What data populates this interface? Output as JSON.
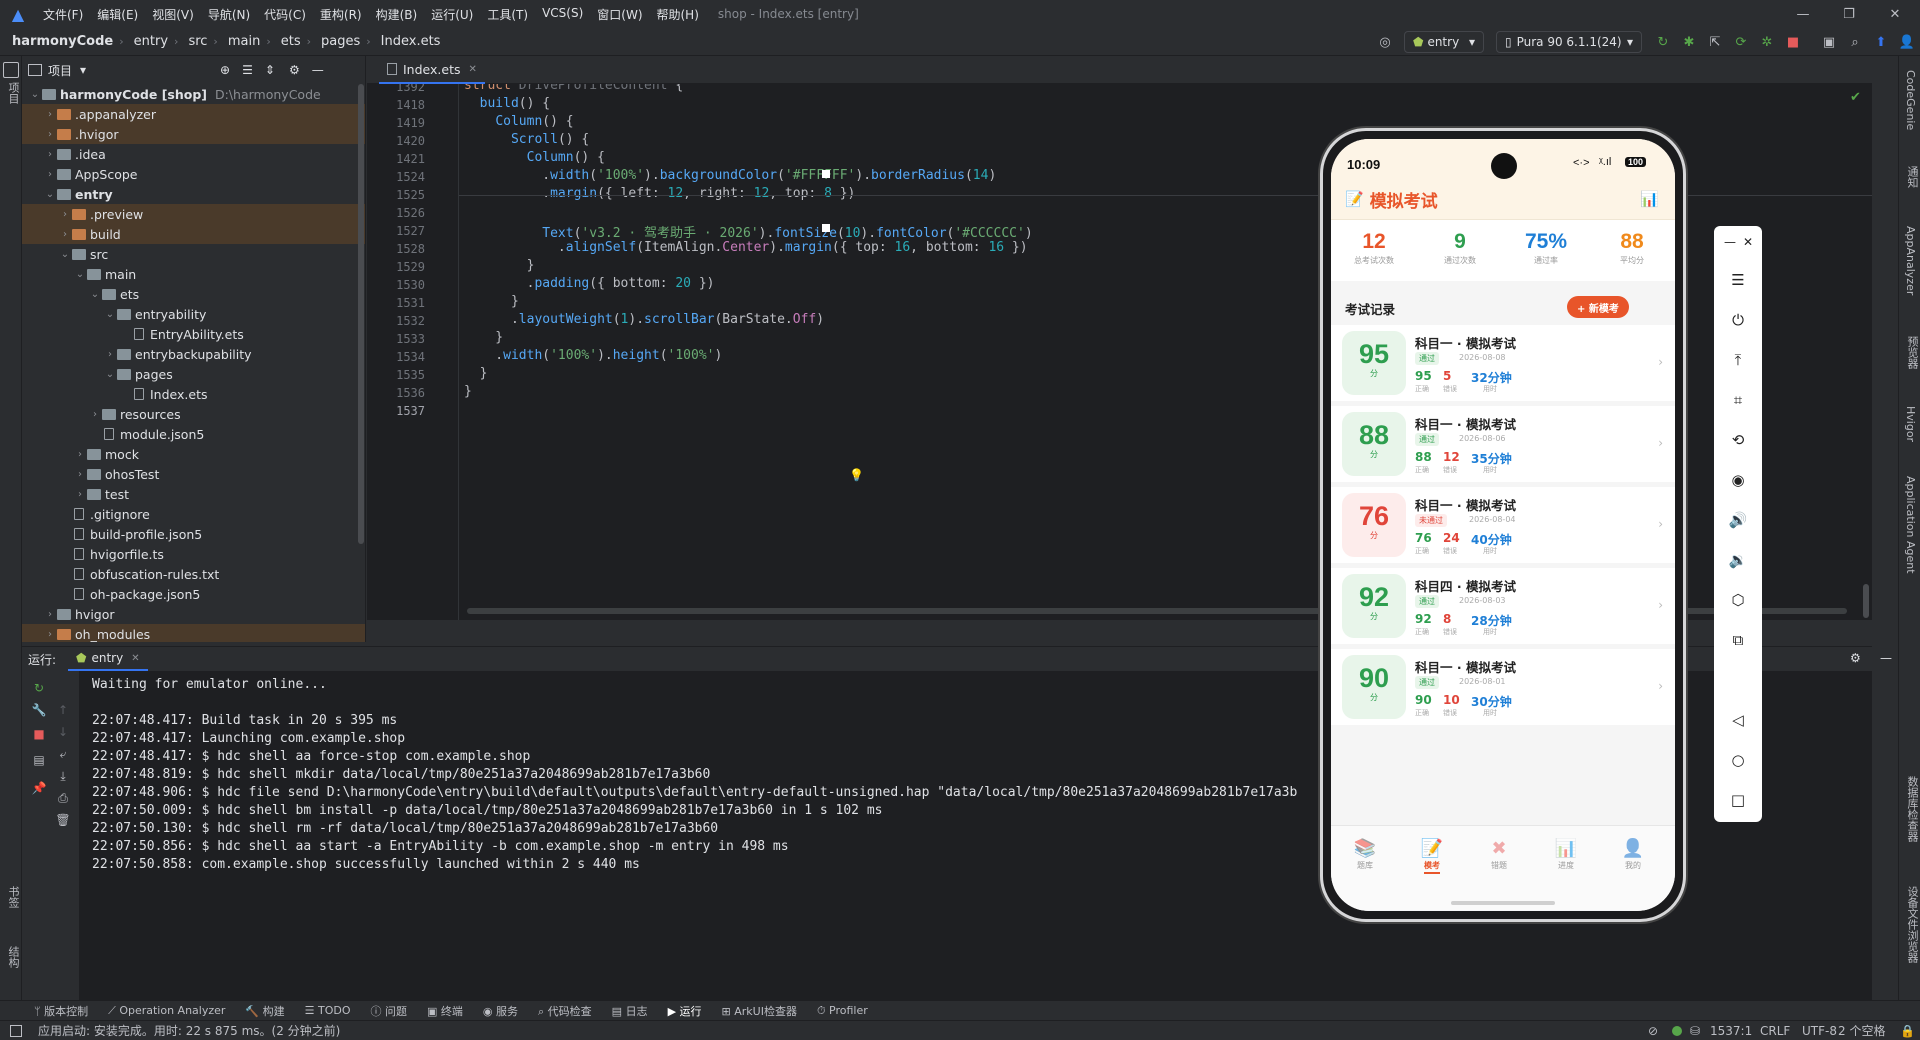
{
  "menubar": {
    "items": [
      "文件(F)",
      "编辑(E)",
      "视图(V)",
      "导航(N)",
      "代码(C)",
      "重构(R)",
      "构建(B)",
      "运行(U)",
      "工具(T)",
      "VCS(S)",
      "窗口(W)",
      "帮助(H)"
    ],
    "title": "shop - Index.ets [entry]"
  },
  "breadcrumb": [
    "harmonyCode",
    "entry",
    "src",
    "main",
    "ets",
    "pages",
    "Index.ets"
  ],
  "toolbar": {
    "run_config": "entry",
    "device": "Pura 90 6.1.1(24)"
  },
  "left_strip": {
    "project": "项目",
    "bookmarks": "书签",
    "structure": "结构"
  },
  "right_strip": {
    "codegenie": "CodeGenie",
    "notifications": "通知",
    "appanalyzer": "AppAnalyzer",
    "preview": "预览器",
    "hvigor": "Hvigor",
    "agent": "Application Agent",
    "db": "数据库检查器",
    "device_files": "设备文件浏览器"
  },
  "project_panel": {
    "title": "项目",
    "tree": [
      {
        "label": "harmonyCode [shop]",
        "hint": "D:\\harmonyCode",
        "depth": 0,
        "open": true,
        "kind": "folder",
        "excl": false,
        "bold": true
      },
      {
        "label": ".appanalyzer",
        "depth": 1,
        "open": false,
        "kind": "folder-or",
        "excl": true
      },
      {
        "label": ".hvigor",
        "depth": 1,
        "open": false,
        "kind": "folder-or",
        "excl": true
      },
      {
        "label": ".idea",
        "depth": 1,
        "open": false,
        "kind": "folder",
        "excl": false
      },
      {
        "label": "AppScope",
        "depth": 1,
        "open": false,
        "kind": "folder",
        "excl": false
      },
      {
        "label": "entry",
        "depth": 1,
        "open": true,
        "kind": "folder",
        "excl": false,
        "bold": true
      },
      {
        "label": ".preview",
        "depth": 2,
        "open": false,
        "kind": "folder-or",
        "excl": true
      },
      {
        "label": "build",
        "depth": 2,
        "open": false,
        "kind": "folder-or",
        "excl": true
      },
      {
        "label": "src",
        "depth": 2,
        "open": true,
        "kind": "folder",
        "excl": false
      },
      {
        "label": "main",
        "depth": 3,
        "open": true,
        "kind": "folder",
        "excl": false
      },
      {
        "label": "ets",
        "depth": 4,
        "open": true,
        "kind": "folder",
        "excl": false
      },
      {
        "label": "entryability",
        "depth": 5,
        "open": true,
        "kind": "folder",
        "excl": false
      },
      {
        "label": "EntryAbility.ets",
        "depth": 6,
        "kind": "file",
        "excl": false
      },
      {
        "label": "entrybackupability",
        "depth": 5,
        "open": false,
        "kind": "folder",
        "excl": false
      },
      {
        "label": "pages",
        "depth": 5,
        "open": true,
        "kind": "folder",
        "excl": false
      },
      {
        "label": "Index.ets",
        "depth": 6,
        "kind": "file",
        "excl": false
      },
      {
        "label": "resources",
        "depth": 4,
        "open": false,
        "kind": "folder",
        "excl": false
      },
      {
        "label": "module.json5",
        "depth": 4,
        "kind": "file",
        "excl": false
      },
      {
        "label": "mock",
        "depth": 3,
        "open": false,
        "kind": "folder",
        "excl": false
      },
      {
        "label": "ohosTest",
        "depth": 3,
        "open": false,
        "kind": "folder",
        "excl": false
      },
      {
        "label": "test",
        "depth": 3,
        "open": false,
        "kind": "folder",
        "excl": false
      },
      {
        "label": ".gitignore",
        "depth": 2,
        "kind": "file",
        "excl": false
      },
      {
        "label": "build-profile.json5",
        "depth": 2,
        "kind": "file",
        "excl": false
      },
      {
        "label": "hvigorfile.ts",
        "depth": 2,
        "kind": "file",
        "excl": false
      },
      {
        "label": "obfuscation-rules.txt",
        "depth": 2,
        "kind": "file",
        "excl": false
      },
      {
        "label": "oh-package.json5",
        "depth": 2,
        "kind": "file",
        "excl": false
      },
      {
        "label": "hvigor",
        "depth": 1,
        "open": false,
        "kind": "folder",
        "excl": false
      },
      {
        "label": "oh_modules",
        "depth": 1,
        "open": false,
        "kind": "folder-or",
        "excl": true
      }
    ]
  },
  "editor": {
    "tab": "Index.ets",
    "lines": [
      {
        "n": "1392",
        "html": "<span class='k'>struct</span> <span class='g'>DriveProfileContent</span> {"
      },
      {
        "n": "1418",
        "html": "  <span class='f'>build</span>() {"
      },
      {
        "n": "1419",
        "html": "    <span class='f'>Column</span>() {"
      },
      {
        "n": "1420",
        "html": "      <span class='f'>Scroll</span>() {"
      },
      {
        "n": "1421",
        "html": "        <span class='f'>Column</span>() {"
      },
      {
        "n": "1524",
        "html": "          .<span class='f'>width</span>(<span class='s'>'100%'</span>).<span class='f'>backgroundColor</span>(<span class='s'>'#FFFFFF'</span>).<span class='f'>borderRadius</span>(<span class='n'>14</span>)"
      },
      {
        "n": "1525",
        "html": "          .<span class='f'>margin</span>({ left: <span class='n'>12</span>, right: <span class='n'>12</span>, top: <span class='n'>8</span> })"
      },
      {
        "n": "1526",
        "html": ""
      },
      {
        "n": "1527",
        "html": "          <span class='f'>Text</span>(<span class='s'>'v3.2 · 驾考助手 · 2026'</span>).<span class='f'>fontSize</span>(<span class='n'>10</span>).<span class='f'>fontColor</span>(<span class='s'>'#CCCCCC'</span>)"
      },
      {
        "n": "1528",
        "html": "            .<span class='f'>alignSelf</span>(ItemAlign.<span class='t'>Center</span>).<span class='f'>margin</span>({ top: <span class='n'>16</span>, bottom: <span class='n'>16</span> })"
      },
      {
        "n": "1529",
        "html": "        }"
      },
      {
        "n": "1530",
        "html": "        .<span class='f'>padding</span>({ bottom: <span class='n'>20</span> })"
      },
      {
        "n": "1531",
        "html": "      }"
      },
      {
        "n": "1532",
        "html": "      .<span class='f'>layoutWeight</span>(<span class='n'>1</span>).<span class='f'>scrollBar</span>(BarState.<span class='t'>Off</span>)"
      },
      {
        "n": "1533",
        "html": "    }"
      },
      {
        "n": "1534",
        "html": "    .<span class='f'>width</span>(<span class='s'>'100%'</span>).<span class='f'>height</span>(<span class='s'>'100%'</span>)"
      },
      {
        "n": "1535",
        "html": "  }"
      },
      {
        "n": "1536",
        "html": "}"
      },
      {
        "n": "1537",
        "html": ""
      }
    ]
  },
  "run_panel": {
    "label": "运行:",
    "tab": "entry",
    "lines": [
      "Waiting for emulator online...",
      "",
      "22:07:48.417: Build task in 20 s 395 ms",
      "22:07:48.417: Launching com.example.shop",
      "22:07:48.417: $ hdc shell aa force-stop com.example.shop",
      "22:07:48.819: $ hdc shell mkdir data/local/tmp/80e251a37a2048699ab281b7e17a3b60",
      "22:07:48.906: $ hdc file send D:\\harmonyCode\\entry\\build\\default\\outputs\\default\\entry-default-unsigned.hap \"data/local/tmp/80e251a37a2048699ab281b7e17a3b",
      "22:07:50.009: $ hdc shell bm install -p data/local/tmp/80e251a37a2048699ab281b7e17a3b60 in 1 s 102 ms",
      "22:07:50.130: $ hdc shell rm -rf data/local/tmp/80e251a37a2048699ab281b7e17a3b60",
      "22:07:50.856: $ hdc shell aa start -a EntryAbility -b com.example.shop -m entry in 498 ms",
      "22:07:50.858: com.example.shop successfully launched within 2 s 440 ms"
    ]
  },
  "tool_strip": [
    "版本控制",
    "Operation Analyzer",
    "构建",
    "TODO",
    "问题",
    "终端",
    "服务",
    "代码检查",
    "日志",
    "运行",
    "ArkUI检查器",
    "Profiler"
  ],
  "status_bar": {
    "message": "应用启动: 安装完成。用时: 22 s 875 ms。(2 分钟之前)",
    "position": "1537:1",
    "line_sep": "CRLF",
    "encoding": "UTF-8",
    "indent": "2 个空格"
  },
  "phone": {
    "time": "10:09",
    "battery": "100",
    "app_title": "模拟考试",
    "stats": [
      {
        "value": "12",
        "label": "总考试次数",
        "color": "#e8552a"
      },
      {
        "value": "9",
        "label": "通过次数",
        "color": "#2e9e4f"
      },
      {
        "value": "75%",
        "label": "通过率",
        "color": "#1f7fd6"
      },
      {
        "value": "88",
        "label": "平均分",
        "color": "#f08a1c"
      }
    ],
    "records_title": "考试记录",
    "new_exam": "+ 新模考",
    "records": [
      {
        "score": "95",
        "unit": "分",
        "title": "科目一 · 模拟考试",
        "badge": "通过",
        "pass": true,
        "date": "2026-08-08",
        "correct": "95",
        "wrong": "5",
        "time": "32分钟",
        "l_correct": "正确",
        "l_wrong": "错误",
        "l_time": "用时"
      },
      {
        "score": "88",
        "unit": "分",
        "title": "科目一 · 模拟考试",
        "badge": "通过",
        "pass": true,
        "date": "2026-08-06",
        "correct": "88",
        "wrong": "12",
        "time": "35分钟",
        "l_correct": "正确",
        "l_wrong": "错误",
        "l_time": "用时"
      },
      {
        "score": "76",
        "unit": "分",
        "title": "科目一 · 模拟考试",
        "badge": "未通过",
        "pass": false,
        "date": "2026-08-04",
        "correct": "76",
        "wrong": "24",
        "time": "40分钟",
        "l_correct": "正确",
        "l_wrong": "错误",
        "l_time": "用时"
      },
      {
        "score": "92",
        "unit": "分",
        "title": "科目四 · 模拟考试",
        "badge": "通过",
        "pass": true,
        "date": "2026-08-03",
        "correct": "92",
        "wrong": "8",
        "time": "28分钟",
        "l_correct": "正确",
        "l_wrong": "错误",
        "l_time": "用时"
      },
      {
        "score": "90",
        "unit": "分",
        "title": "科目一 · 模拟考试",
        "badge": "通过",
        "pass": true,
        "date": "2026-08-01",
        "correct": "90",
        "wrong": "10",
        "time": "30分钟",
        "l_correct": "正确",
        "l_wrong": "错误",
        "l_time": "用时"
      }
    ],
    "nav": [
      {
        "label": "题库",
        "icon": "📚",
        "active": false
      },
      {
        "label": "模考",
        "icon": "📝",
        "active": true
      },
      {
        "label": "错题",
        "icon": "✖",
        "active": false
      },
      {
        "label": "进度",
        "icon": "📊",
        "active": false
      },
      {
        "label": "我的",
        "icon": "👤",
        "active": false
      }
    ]
  },
  "colors": {
    "accent": "#3574f0",
    "pass": "#2e9e4f",
    "fail": "#e0453a",
    "brand": "#e8552a"
  }
}
